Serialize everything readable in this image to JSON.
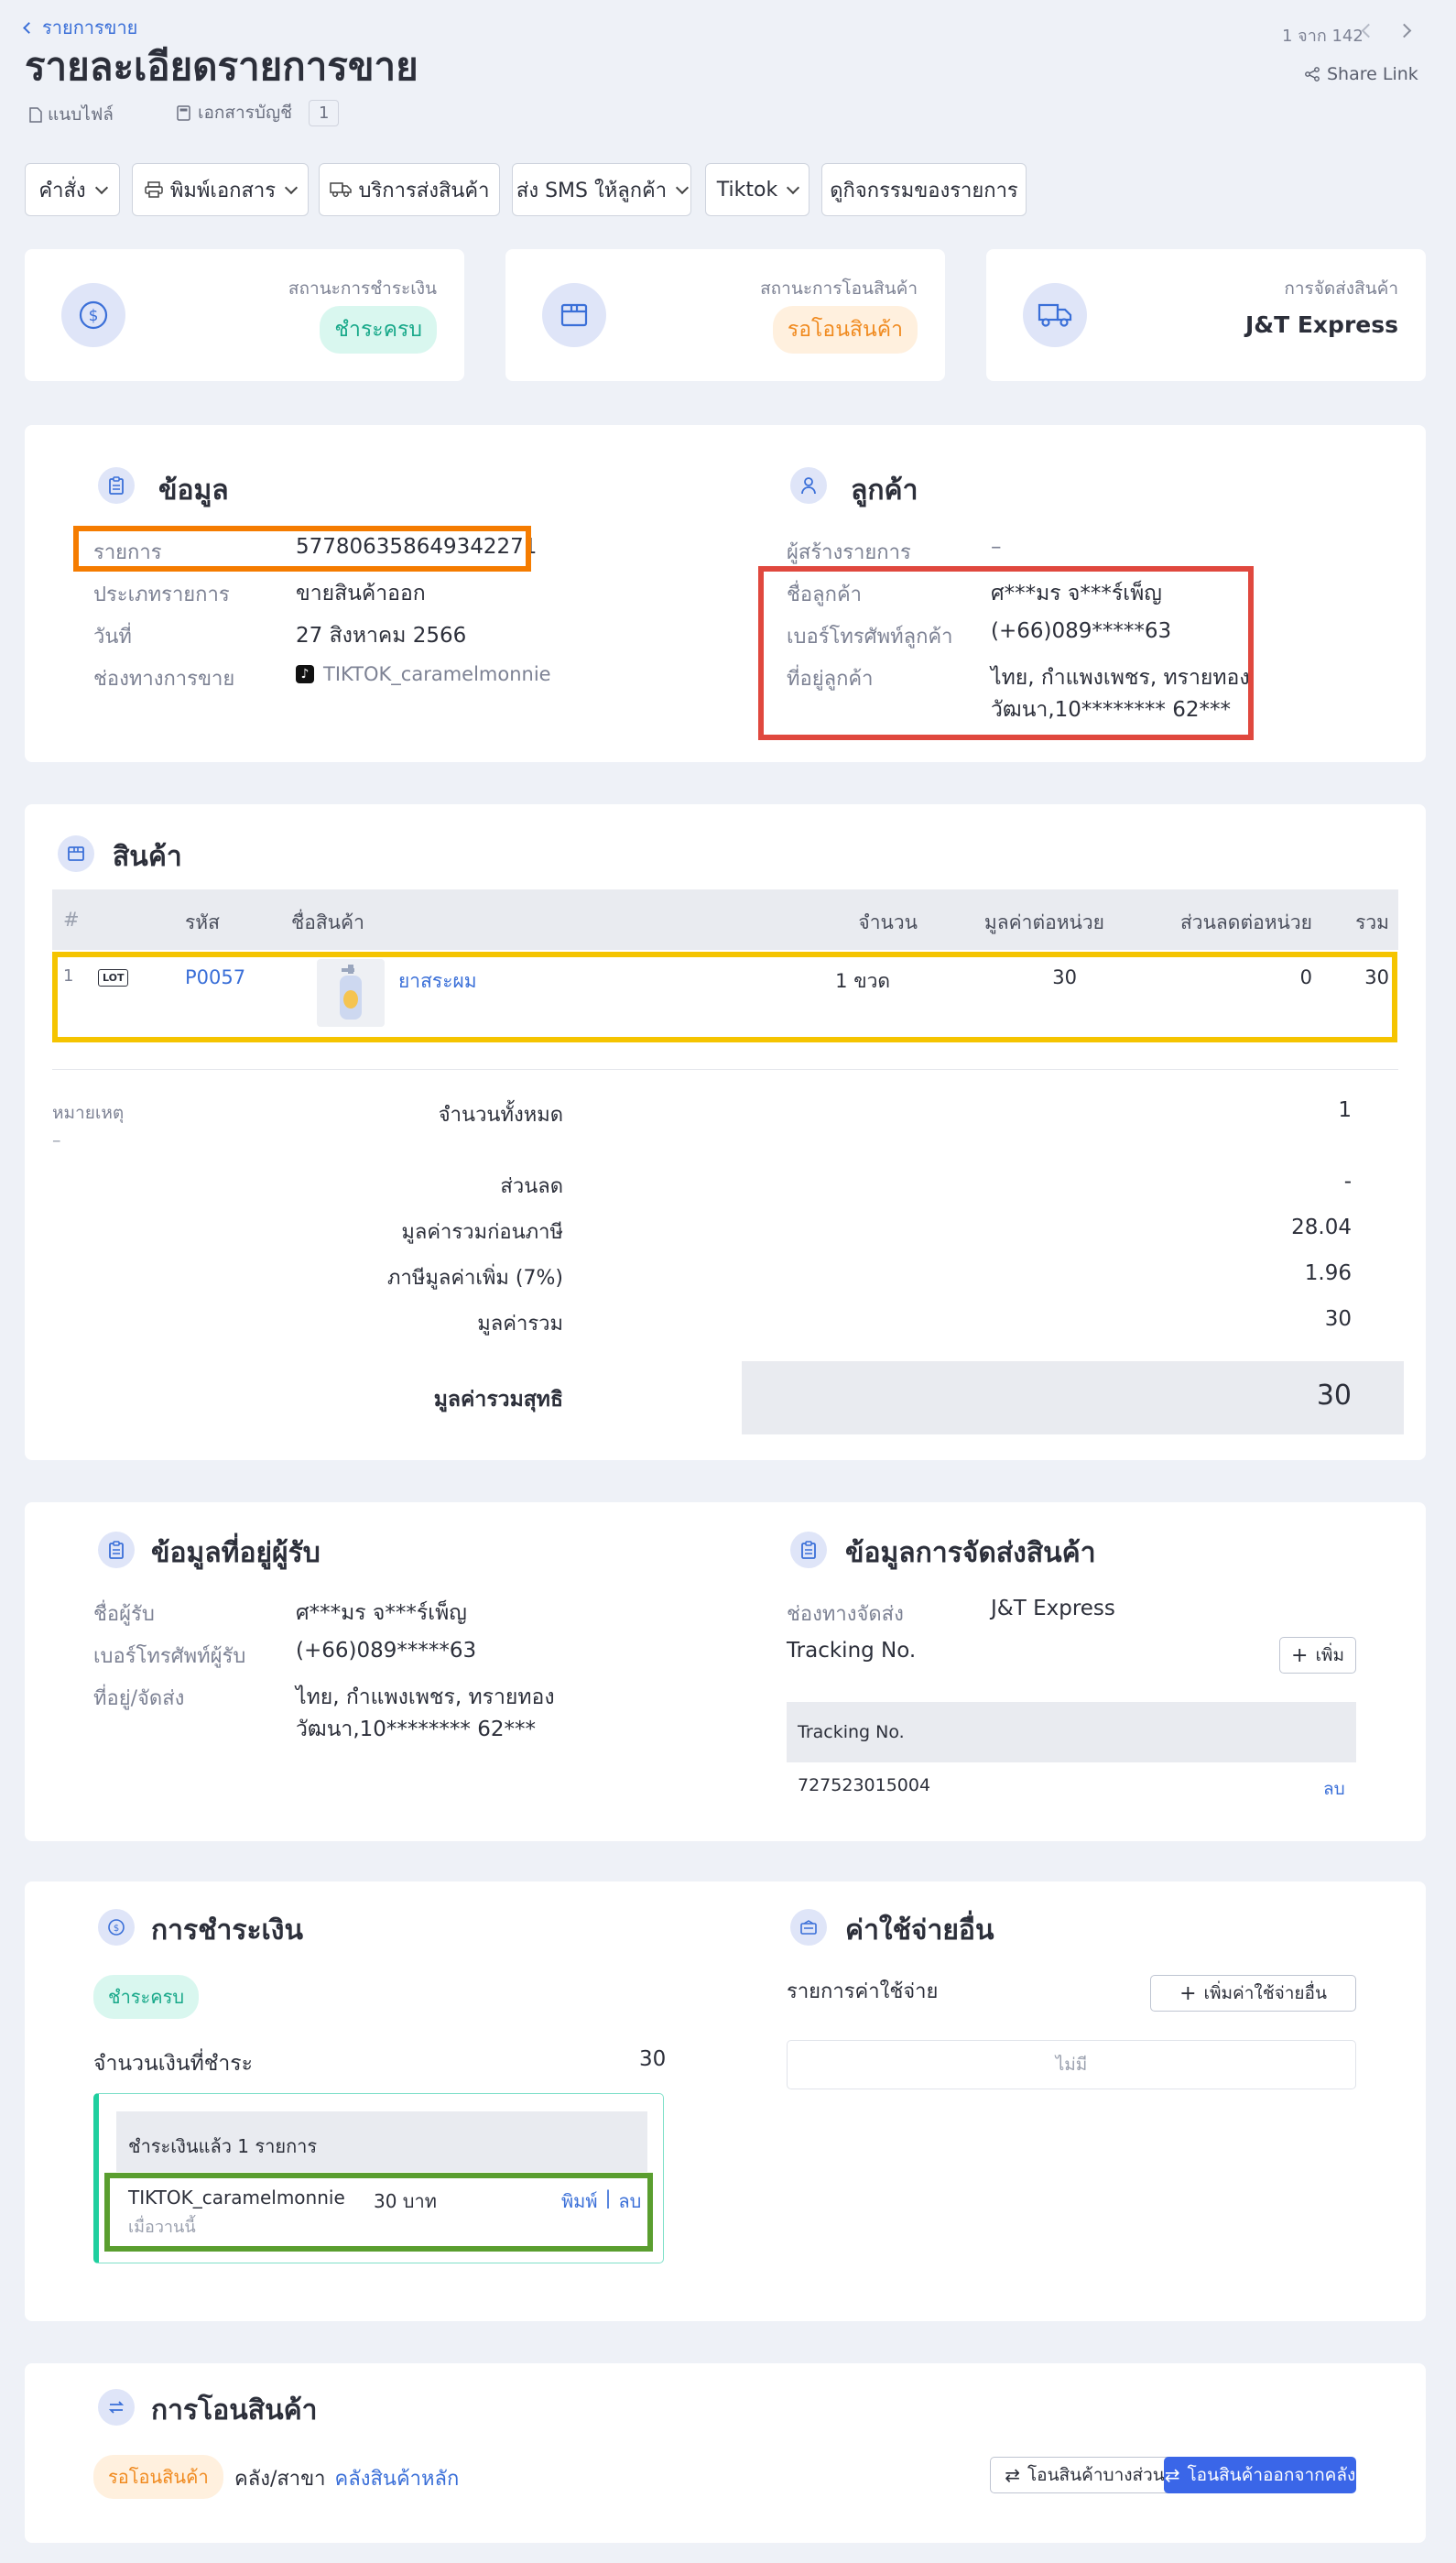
{
  "header": {
    "breadcrumb": "รายการขาย",
    "title": "รายละเอียดรายการขาย",
    "tab_files": "แนบไฟล์",
    "tab_accounting": "เอกสารบัญชี",
    "accounting_count": "1",
    "pager": "1 จาก 142",
    "share_link": "Share Link"
  },
  "toolbar": {
    "command": "คำสั่ง",
    "print": "พิมพ์เอกสาร",
    "shipping": "บริการส่งสินค้า",
    "sms": "ส่ง SMS ให้ลูกค้า",
    "tiktok": "Tiktok",
    "activity": "ดูกิจกรรมของรายการ"
  },
  "status_cards": {
    "payment": {
      "label": "สถานะการชำระเงิน",
      "value": "ชำระครบ"
    },
    "transfer": {
      "label": "สถานะการโอนสินค้า",
      "value": "รอโอนสินค้า"
    },
    "delivery": {
      "label": "การจัดส่งสินค้า",
      "value": "J&T Express"
    }
  },
  "info": {
    "title": "ข้อมูล",
    "order_label": "รายการ",
    "order_value": "577806358649342271",
    "type_label": "ประเภทรายการ",
    "type_value": "ขายสินค้าออก",
    "date_label": "วันที่",
    "date_value": "27 สิงหาคม 2566",
    "channel_label": "ช่องทางการขาย",
    "channel_value": "TIKTOK_caramelmonnie"
  },
  "customer": {
    "title": "ลูกค้า",
    "creator_label": "ผู้สร้างรายการ",
    "creator_value": "–",
    "name_label": "ชื่อลูกค้า",
    "name_value": "ศ***มร จ***ร์เพ็ญ",
    "phone_label": "เบอร์โทรศัพท์ลูกค้า",
    "phone_value": "(+66)089*****63",
    "address_label": "ที่อยู่ลูกค้า",
    "address_line1": "ไทย, กำแพงเพชร, ทรายทอง",
    "address_line2": "วัฒนา,10******** 62***"
  },
  "products": {
    "title": "สินค้า",
    "columns": {
      "index": "#",
      "code": "รหัส",
      "name": "ชื่อสินค้า",
      "qty": "จำนวน",
      "unit_price": "มูลค่าต่อหน่วย",
      "discount": "ส่วนลดต่อหน่วย",
      "total": "รวม"
    },
    "row": {
      "index": "1",
      "badge": "LOT",
      "code": "P0057",
      "name": "ยาสระผม",
      "qty": "1 ขวด",
      "unit_price": "30",
      "discount": "0",
      "total": "30"
    }
  },
  "summary": {
    "note_label": "หมายเหตุ",
    "note_value": "–",
    "qty_label": "จำนวนทั้งหมด",
    "qty_value": "1",
    "discount_label": "ส่วนลด",
    "discount_value": "-",
    "pretax_label": "มูลค่ารวมก่อนภาษี",
    "pretax_value": "28.04",
    "vat_label": "ภาษีมูลค่าเพิ่ม (7%)",
    "vat_value": "1.96",
    "total_label": "มูลค่ารวม",
    "total_value": "30",
    "net_label": "มูลค่ารวมสุทธิ",
    "net_value": "30"
  },
  "recipient": {
    "title": "ข้อมูลที่อยู่ผู้รับ",
    "name_label": "ชื่อผู้รับ",
    "name_value": "ศ***มร จ***ร์เพ็ญ",
    "phone_label": "เบอร์โทรศัพท์ผู้รับ",
    "phone_value": "(+66)089*****63",
    "address_label": "ที่อยู่/จัดส่ง",
    "address_line1": "ไทย, กำแพงเพชร, ทรายทอง",
    "address_line2": "วัฒนา,10******** 62***"
  },
  "shipping": {
    "title": "ข้อมูลการจัดส่งสินค้า",
    "channel_label": "ช่องทางจัดส่ง",
    "channel_value": "J&T Express",
    "tracking_label": "Tracking No.",
    "add_button": "เพิ่ม",
    "table_header": "Tracking No.",
    "tracking_value": "727523015004",
    "delete": "ลบ"
  },
  "payment": {
    "title": "การชำระเงิน",
    "status": "ชำระครบ",
    "amount_label": "จำนวนเงินที่ชำระ",
    "amount_value": "30",
    "paid_header": "ชำระเงินแล้ว 1 รายการ",
    "entry_channel": "TIKTOK_caramelmonnie",
    "entry_amount": "30 บาท",
    "entry_time": "เมื่อวานนี้",
    "print": "พิมพ์",
    "separator": "|",
    "delete": "ลบ"
  },
  "expenses": {
    "title": "ค่าใช้จ่ายอื่น",
    "label": "รายการค่าใช้จ่าย",
    "add_button": "เพิ่มค่าใช้จ่ายอื่น",
    "empty": "ไม่มี"
  },
  "transfer": {
    "title": "การโอนสินค้า",
    "status": "รอโอนสินค้า",
    "warehouse_label": "คลัง/สาขา",
    "warehouse_value": "คลังสินค้าหลัก",
    "partial_button": "โอนสินค้าบางส่วน",
    "out_button": "โอนสินค้าออกจากคลัง"
  },
  "colors": {
    "accent": "#3a6fd8",
    "highlight_orange": "#f57c00",
    "highlight_red": "#e0483e",
    "highlight_yellow": "#f5c400",
    "highlight_green": "#5a9e2f"
  }
}
